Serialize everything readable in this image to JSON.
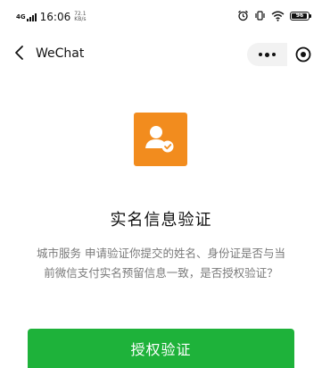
{
  "status_bar": {
    "network": "4G",
    "time": "16:06",
    "speed_value": "72.1",
    "speed_unit": "KB/s",
    "battery": "96",
    "battery_level": 0.96,
    "icons": [
      "alarm-icon",
      "vibrate-icon",
      "wifi-icon",
      "battery-icon"
    ]
  },
  "nav": {
    "title": "WeChat",
    "icons": [
      "back-icon",
      "more-icon",
      "close-icon"
    ]
  },
  "main": {
    "icon": "user-verified-icon",
    "icon_color": "#f28c1e",
    "title": "实名信息验证",
    "description_line1": "城市服务 申请验证你提交的姓名、身份证是否与当",
    "description_line2": "前微信支付实名预留信息一致，是否授权验证？",
    "button_label": "授权验证",
    "button_color": "#1eb23a"
  }
}
